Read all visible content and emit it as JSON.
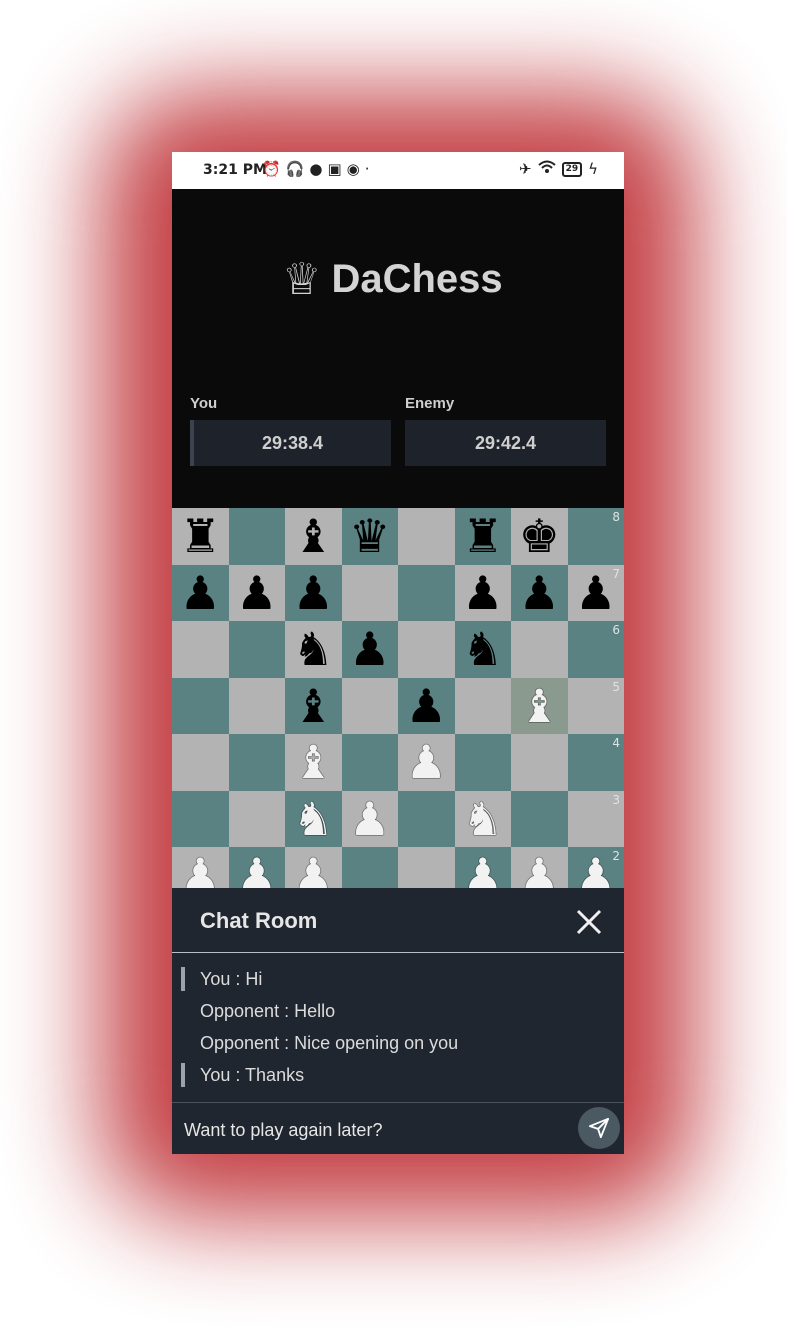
{
  "status_bar": {
    "time": "3:21 PM",
    "left_icons": [
      "alarm-icon",
      "headphones-icon",
      "spotify-icon",
      "twitch-icon",
      "github-icon",
      "dot-icon"
    ],
    "right_icons": [
      "airplane-icon",
      "wifi-icon",
      "battery-icon",
      "charging-icon"
    ],
    "battery_level": "29"
  },
  "app": {
    "logo_glyph": "♕",
    "title": "DaChess"
  },
  "players": {
    "you": {
      "label": "You",
      "time": "29:38.4"
    },
    "enemy": {
      "label": "Enemy",
      "time": "29:42.4"
    }
  },
  "board": {
    "colors": {
      "light": "#b3b3b3",
      "dark": "#5a8282",
      "highlight": "#8a9a8f"
    },
    "ranks": [
      {
        "rank": "8",
        "squares": [
          "bR",
          "",
          "bB",
          "bQ",
          "",
          "bR",
          "bK",
          ""
        ]
      },
      {
        "rank": "7",
        "squares": [
          "bP",
          "bP",
          "bP",
          "",
          "",
          "bP",
          "bP",
          "bP"
        ]
      },
      {
        "rank": "6",
        "squares": [
          "",
          "",
          "bN",
          "bP",
          "",
          "bN",
          "",
          ""
        ]
      },
      {
        "rank": "5",
        "squares": [
          "",
          "",
          "bB",
          "",
          "bP",
          "",
          "wB",
          ""
        ]
      },
      {
        "rank": "4",
        "squares": [
          "",
          "",
          "wB",
          "",
          "wP",
          "",
          "",
          ""
        ]
      },
      {
        "rank": "3",
        "squares": [
          "",
          "",
          "wN",
          "wP",
          "",
          "wN",
          "",
          ""
        ]
      },
      {
        "rank": "2",
        "squares": [
          "wP",
          "wP",
          "wP",
          "",
          "",
          "wP",
          "wP",
          "wP"
        ]
      }
    ],
    "highlighted_square": "g5"
  },
  "chat": {
    "title": "Chat Room",
    "messages": [
      {
        "sender": "you",
        "text": "You : Hi"
      },
      {
        "sender": "opponent",
        "text": "Opponent : Hello"
      },
      {
        "sender": "opponent",
        "text": "Opponent : Nice opening on you"
      },
      {
        "sender": "you",
        "text": "You : Thanks"
      }
    ],
    "input_value": "Want to play again later?"
  }
}
